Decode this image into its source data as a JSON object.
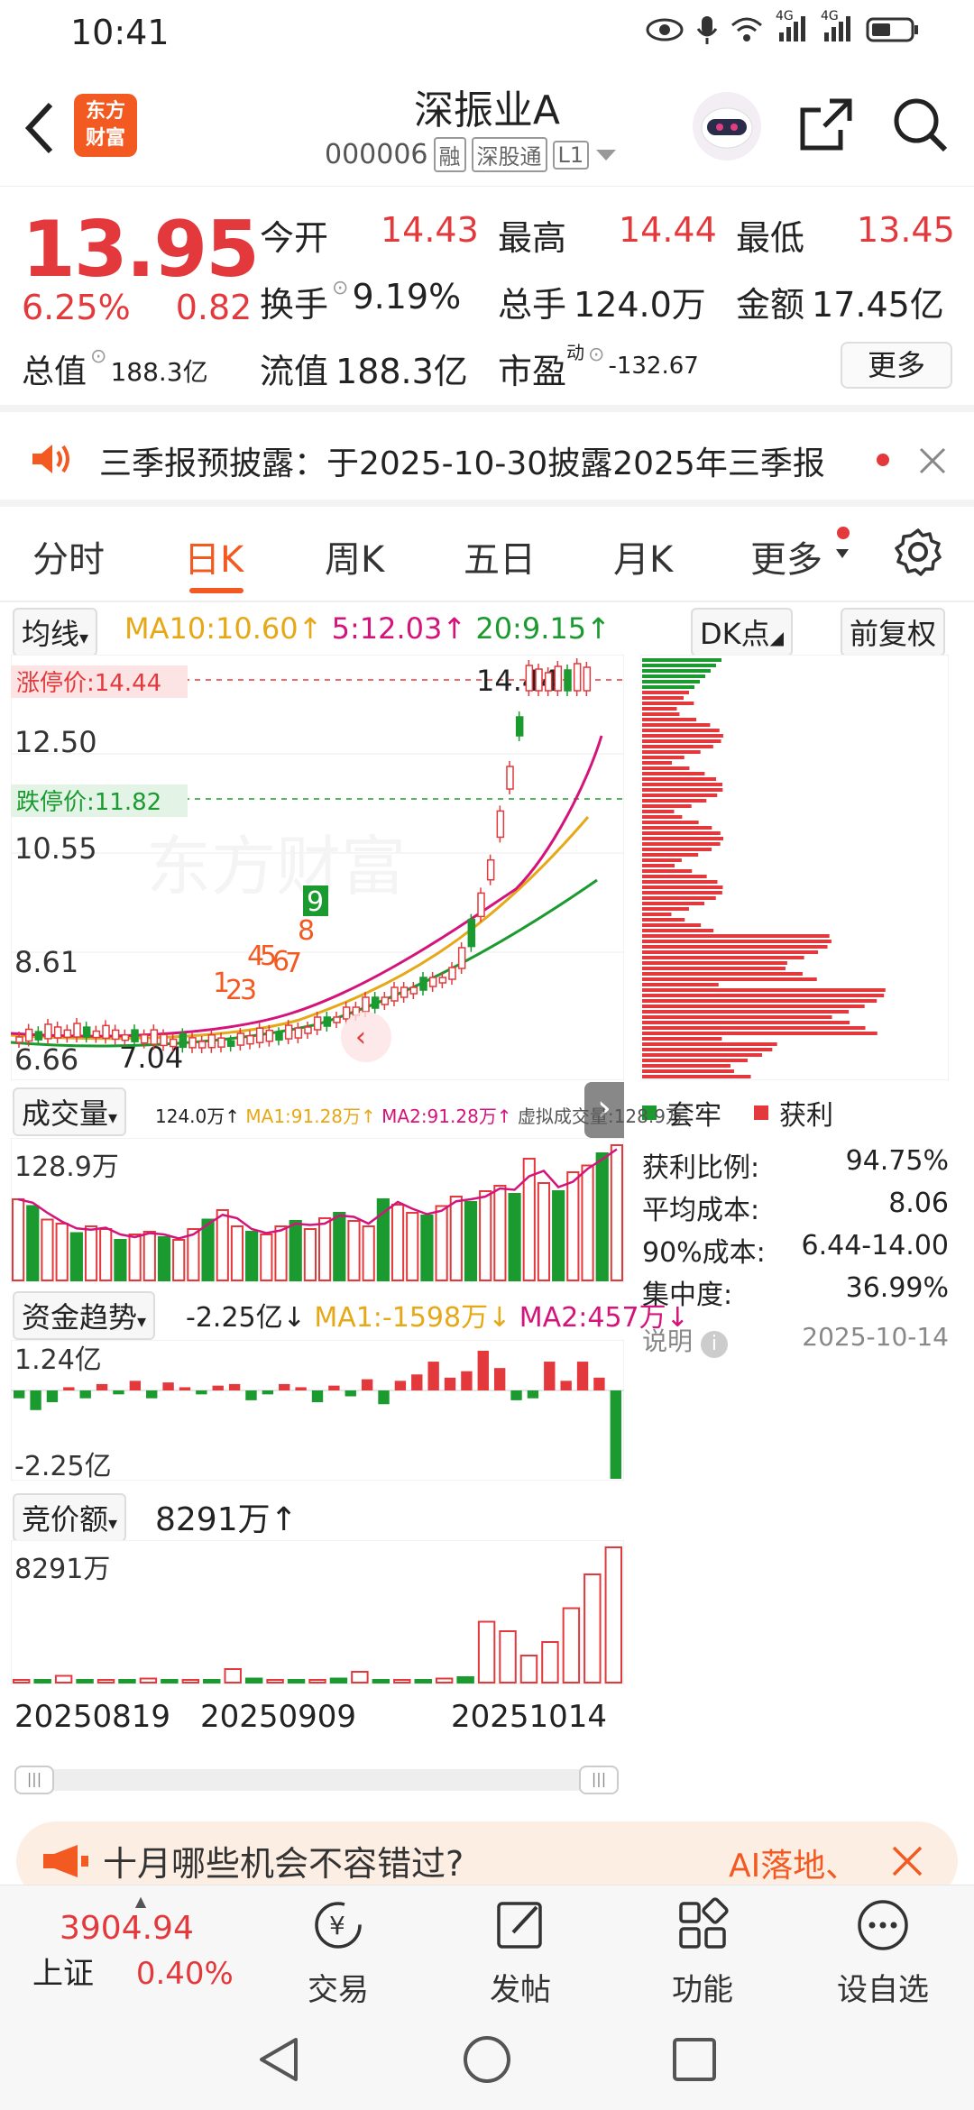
{
  "status": {
    "time": "10:41",
    "net1": "4G",
    "net2": "4G"
  },
  "header": {
    "logo_line1": "东方",
    "logo_line2": "财富",
    "name": "深振业A",
    "code": "000006",
    "tags": [
      "融",
      "深股通",
      "L1"
    ]
  },
  "quote": {
    "price": "13.95",
    "change_pct": "6.25%",
    "change": "0.82",
    "open_label": "今开",
    "open": "14.43",
    "high_label": "最高",
    "high": "14.44",
    "low_label": "最低",
    "low": "13.45",
    "turnover_label": "换手",
    "turnover": "9.19%",
    "volume_label": "总手",
    "volume": "124.0万",
    "amount_label": "金额",
    "amount": "17.45亿",
    "mktcap_label": "总值",
    "mktcap": "188.3亿",
    "float_label": "流值",
    "float": "188.3亿",
    "pe_label": "市盈",
    "pe_sup": "动",
    "pe": "-132.67",
    "more": "更多"
  },
  "notice": {
    "text": "三季报预披露：于2025-10-30披露2025年三季报"
  },
  "tabs": [
    "分时",
    "日K",
    "周K",
    "五日",
    "月K",
    "更多"
  ],
  "kline": {
    "ma_toggle": "均线",
    "ma10": "MA10:10.60↑",
    "ma5": "5:12.03↑",
    "ma20": "20:9.15↑",
    "dk": "DK点",
    "adjust": "前复权",
    "limit_up": "涨停价:14.44",
    "limit_down": "跌停价:11.82",
    "y_labels": [
      "12.50",
      "10.55",
      "8.61",
      "6.66"
    ],
    "high_mark": "14.44",
    "low_mark": "7.04",
    "signal_numbers": [
      "1",
      "2",
      "3",
      "4",
      "5",
      "6",
      "7",
      "8",
      "9"
    ]
  },
  "volume": {
    "selector": "成交量",
    "legend": "124.0万↑",
    "ma1": "MA1:91.28万↑",
    "ma2": "MA2:91.28万↑",
    "virtual": "虚拟成交量:128.9万",
    "max_label": "128.9万",
    "values": [
      60,
      55,
      45,
      42,
      35,
      40,
      38,
      30,
      34,
      36,
      32,
      30,
      38,
      45,
      52,
      40,
      36,
      34,
      40,
      44,
      38,
      46,
      50,
      44,
      40,
      60,
      56,
      50,
      48,
      55,
      62,
      58,
      66,
      70,
      64,
      90,
      72,
      66,
      80,
      85,
      94,
      100
    ]
  },
  "capital": {
    "selector": "资金趋势",
    "value": "-2.25亿↓",
    "ma1": "MA1:-1598万↓",
    "ma2": "MA2:457万↓",
    "top_label": "1.24亿",
    "bottom_label": "-2.25亿",
    "values": [
      -0.2,
      -0.5,
      -0.3,
      0.1,
      -0.2,
      0.2,
      -0.1,
      0.3,
      -0.2,
      0.25,
      0.1,
      -0.1,
      0.15,
      0.2,
      -0.25,
      -0.1,
      0.2,
      0.1,
      -0.3,
      0.15,
      -0.15,
      0.35,
      -0.35,
      0.3,
      0.5,
      0.9,
      0.4,
      0.6,
      1.24,
      0.7,
      -0.25,
      -0.2,
      0.9,
      0.3,
      0.9,
      0.4,
      -2.25
    ]
  },
  "auction": {
    "selector": "竞价额",
    "value": "8291万↑",
    "max_label": "8291万",
    "values": [
      2,
      1,
      5,
      1,
      2,
      1,
      3,
      1,
      2,
      1,
      10,
      3,
      2,
      1,
      2,
      3,
      8,
      2,
      1,
      2,
      3,
      4,
      45,
      38,
      20,
      30,
      55,
      80,
      100
    ],
    "dates": [
      "20250819",
      "20250909",
      "20251014"
    ]
  },
  "chips": {
    "legend_trapped": "套牢",
    "legend_profit": "获利",
    "rows": [
      {
        "label": "获利比例:",
        "value": "94.75%"
      },
      {
        "label": "平均成本:",
        "value": "8.06"
      },
      {
        "label": "90%成本:",
        "value": "6.44-14.00"
      },
      {
        "label": "集中度:",
        "value": "36.99%"
      }
    ],
    "note_label": "说明",
    "date": "2025-10-14"
  },
  "banner": {
    "text": "十月哪些机会不容错过?",
    "right": "AI落地、"
  },
  "tabbar": {
    "index_value": "3904.94",
    "index_name": "上证",
    "index_pct": "0.40%",
    "items": [
      "交易",
      "发帖",
      "功能",
      "设自选"
    ]
  }
}
